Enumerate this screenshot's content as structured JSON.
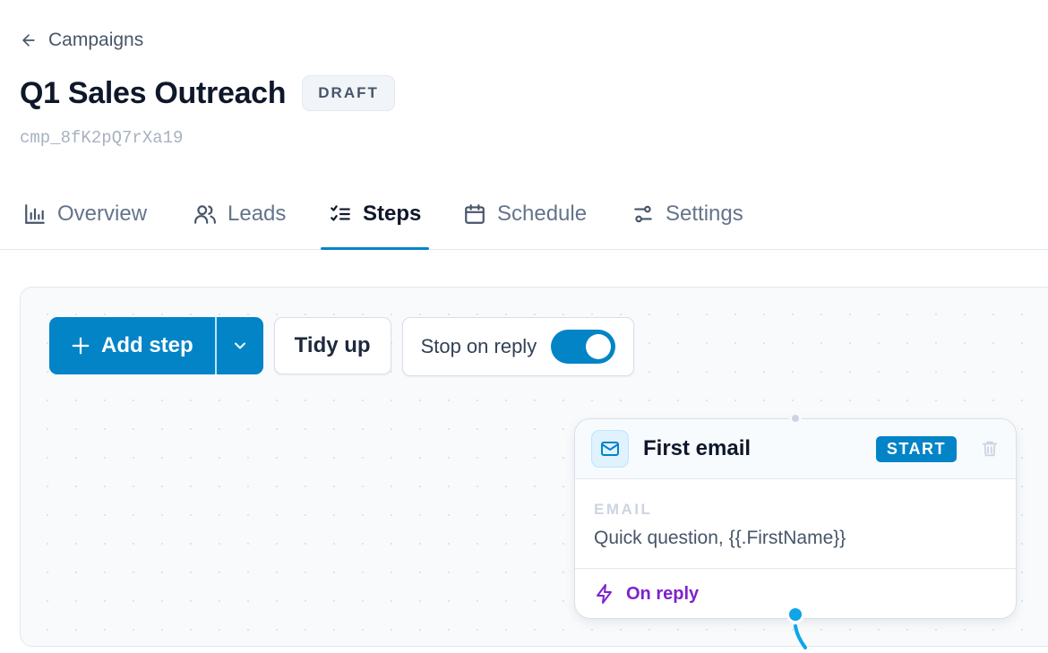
{
  "back": {
    "label": "Campaigns",
    "icon": "arrow-left-icon"
  },
  "campaign": {
    "title": "Q1 Sales Outreach",
    "status": "DRAFT",
    "id": "cmp_8fK2pQ7rXa19"
  },
  "tabs": [
    {
      "label": "Overview",
      "icon": "bar-chart-icon"
    },
    {
      "label": "Leads",
      "icon": "users-icon"
    },
    {
      "label": "Steps",
      "icon": "list-checks-icon",
      "active": true
    },
    {
      "label": "Schedule",
      "icon": "calendar-icon"
    },
    {
      "label": "Settings",
      "icon": "sliders-icon"
    }
  ],
  "toolbar": {
    "add_step": "Add step",
    "tidy_up": "Tidy up",
    "stop_on_reply": {
      "label": "Stop on reply",
      "enabled": true
    }
  },
  "node": {
    "title": "First email",
    "badge": "START",
    "type_label": "EMAIL",
    "subject": "Quick question, {{.FirstName}}",
    "branch_label": "On reply"
  },
  "colors": {
    "accent": "#0284c7",
    "branch": "#7e22ce",
    "handle": "#0ea5e9"
  }
}
